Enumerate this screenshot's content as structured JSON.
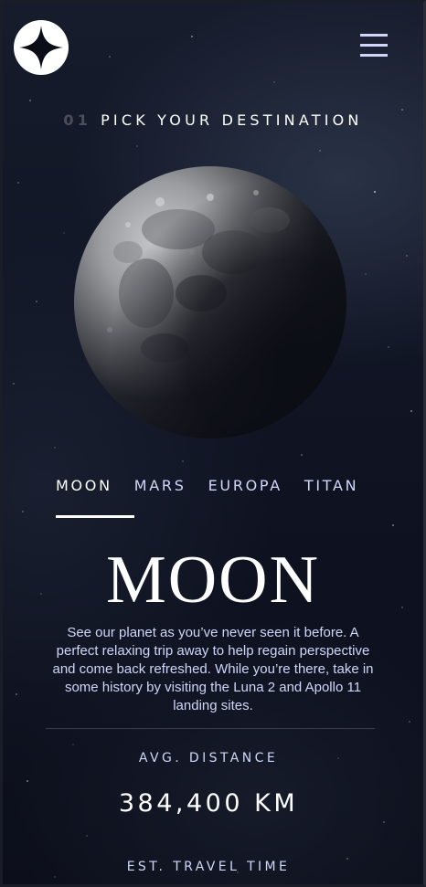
{
  "header": {
    "logo_icon": "four-point-star-logo-icon",
    "menu_icon": "hamburger-menu-icon"
  },
  "page_heading": {
    "number": "01",
    "title": "PICK YOUR DESTINATION"
  },
  "planet_image": "moon-image",
  "tabs": [
    {
      "label": "MOON",
      "active": true
    },
    {
      "label": "MARS",
      "active": false
    },
    {
      "label": "EUROPA",
      "active": false
    },
    {
      "label": "TITAN",
      "active": false
    }
  ],
  "destination": {
    "name": "MOON",
    "description": "See our planet as you’ve never seen it before. A perfect relaxing trip away to help regain perspective and come back refreshed. While you’re there, take in some history by visiting the Luna 2 and Apollo 11 landing sites.",
    "avg_distance_label": "AVG. DISTANCE",
    "avg_distance_value": "384,400 KM",
    "travel_time_label": "EST. TRAVEL TIME"
  },
  "colors": {
    "background": "#0b0d17",
    "accent_light": "#d0d6f9",
    "text": "#ffffff",
    "muted_number": "#4b4e5a"
  }
}
